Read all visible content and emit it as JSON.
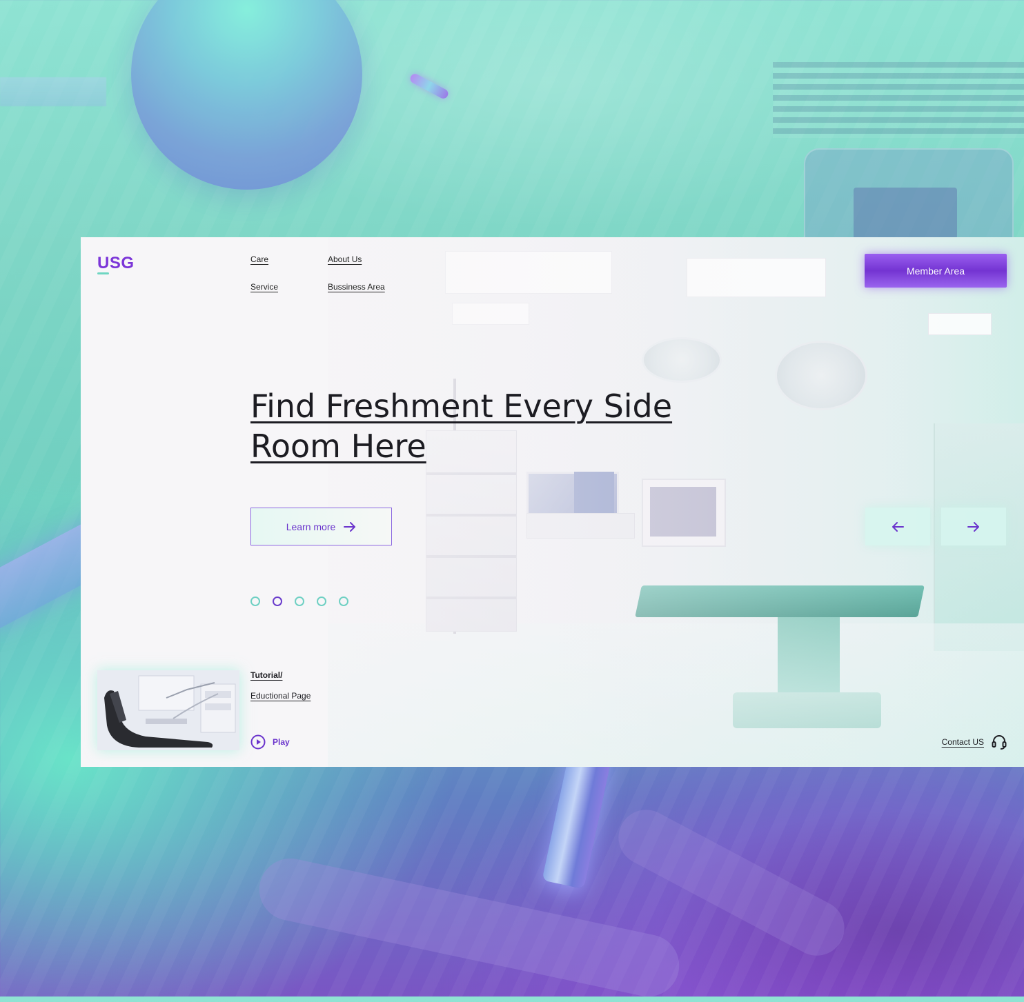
{
  "brand": {
    "logo": "USG",
    "accent": "#7b35d8",
    "secondary": "#6fd6c2"
  },
  "nav": {
    "items": [
      {
        "label": "Care"
      },
      {
        "label": "About Us"
      },
      {
        "label": "Service"
      },
      {
        "label": "Bussiness Area"
      }
    ],
    "member_button": "Member Area"
  },
  "hero": {
    "headline_line1": "Find Freshment Every Side",
    "headline_line2": "Room Here",
    "cta_label": "Learn more",
    "cta_icon": "arrow-right-icon",
    "prev_icon": "arrow-left-icon",
    "next_icon": "arrow-right-icon",
    "slides": {
      "count": 5,
      "active_index": 1
    }
  },
  "tutorial": {
    "title": "Tutorial/",
    "subtitle": "Eductional Page",
    "play_label": "Play",
    "play_icon": "play-circle-icon"
  },
  "contact": {
    "label": "Contact US",
    "icon": "headset-icon"
  }
}
